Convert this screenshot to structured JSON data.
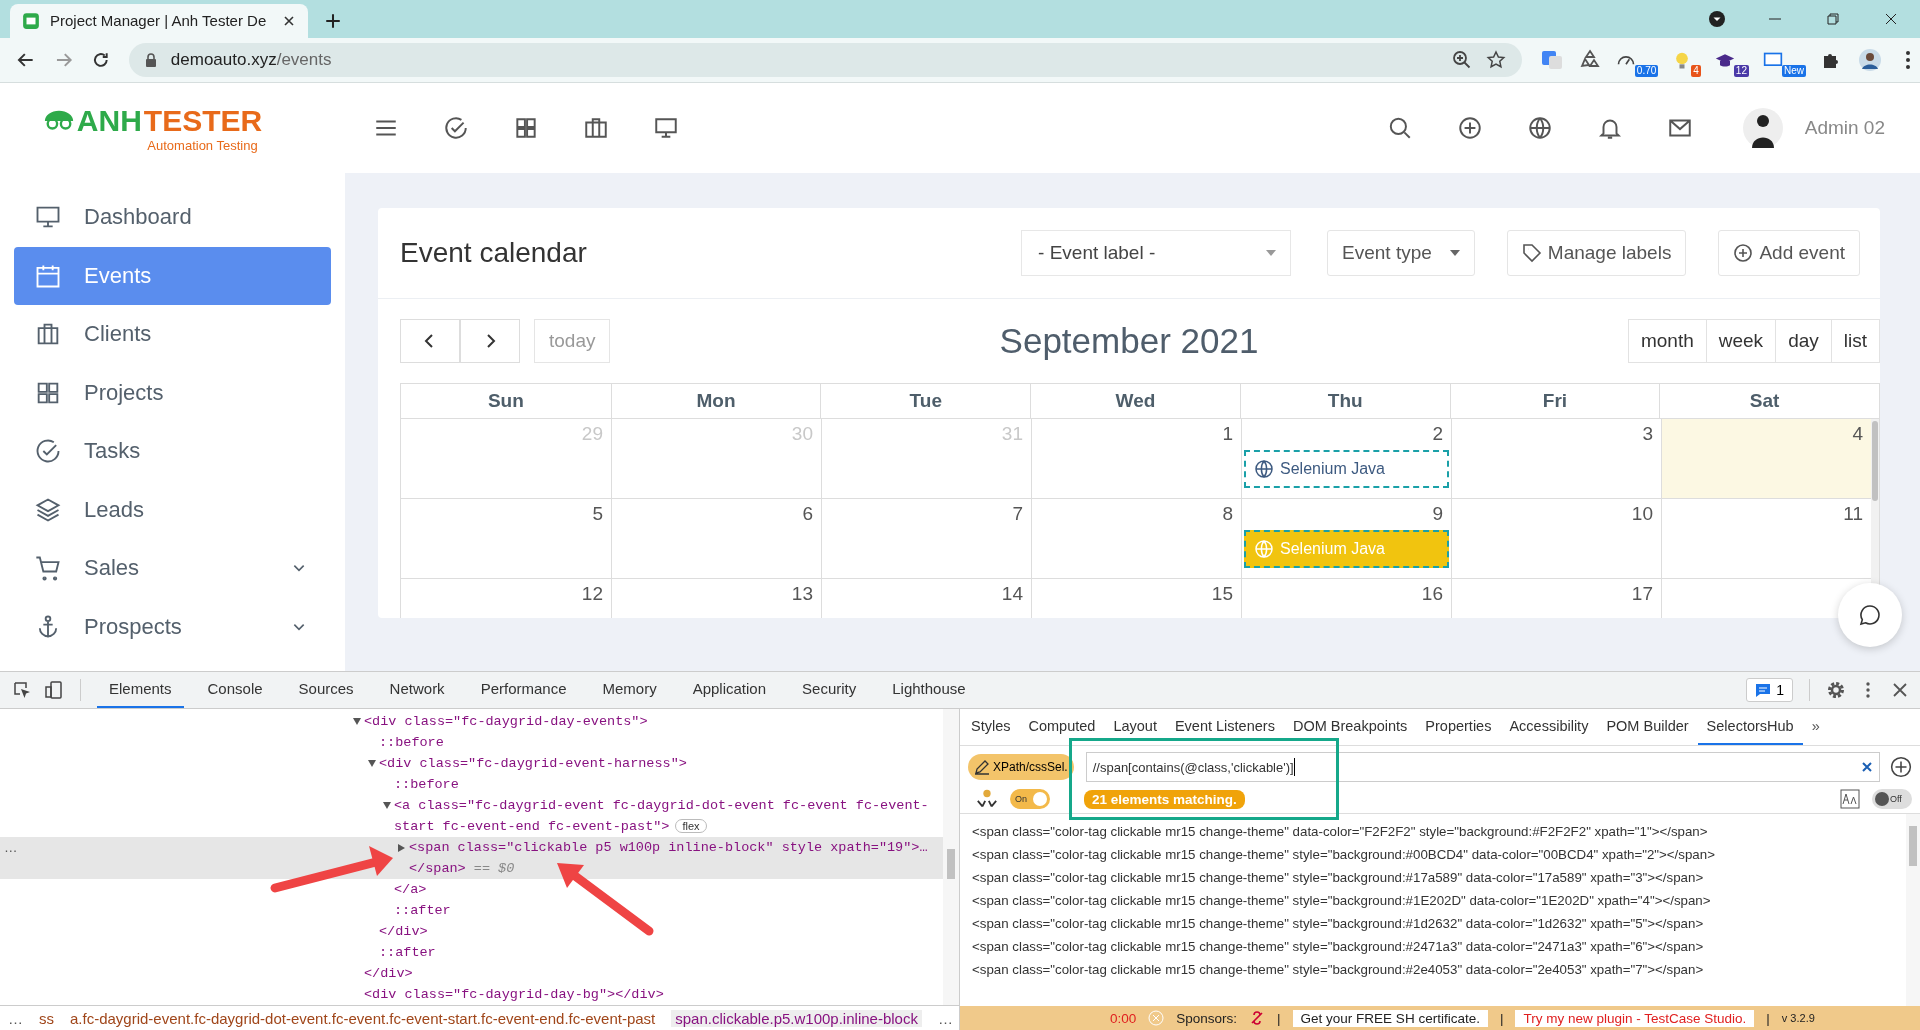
{
  "browser": {
    "tab_title": "Project Manager | Anh Tester De",
    "url_host": "demoauto.xyz",
    "url_path": "/events",
    "extension_badges": [
      "0.70",
      "4",
      "12",
      "New"
    ]
  },
  "header": {
    "logo_part_1": "ANH",
    "logo_part_2": "TESTER",
    "logo_tagline": "Automation Testing",
    "user": "Admin 02"
  },
  "sidebar": {
    "items": [
      {
        "label": "Dashboard",
        "selected": false,
        "submenu": false
      },
      {
        "label": "Events",
        "selected": true,
        "submenu": false
      },
      {
        "label": "Clients",
        "selected": false,
        "submenu": false
      },
      {
        "label": "Projects",
        "selected": false,
        "submenu": false
      },
      {
        "label": "Tasks",
        "selected": false,
        "submenu": false
      },
      {
        "label": "Leads",
        "selected": false,
        "submenu": false
      },
      {
        "label": "Sales",
        "selected": false,
        "submenu": true
      },
      {
        "label": "Prospects",
        "selected": false,
        "submenu": true
      }
    ]
  },
  "calendar": {
    "title": "Event calendar",
    "event_label_select": "- Event label -",
    "event_type": "Event type",
    "manage_labels": "Manage labels",
    "add_event": "Add event",
    "today": "today",
    "month_title": "September 2021",
    "views": [
      "month",
      "week",
      "day",
      "list"
    ],
    "weekdays": [
      "Sun",
      "Mon",
      "Tue",
      "Wed",
      "Thu",
      "Fri",
      "Sat"
    ],
    "weeks": [
      [
        {
          "day": "29",
          "other_month": true,
          "today": false
        },
        {
          "day": "30",
          "other_month": true,
          "today": false
        },
        {
          "day": "31",
          "other_month": true,
          "today": false
        },
        {
          "day": "1",
          "other_month": false,
          "today": false
        },
        {
          "day": "2",
          "other_month": false,
          "today": false,
          "events": [
            {
              "label": "Selenium Java",
              "selected": false
            }
          ]
        },
        {
          "day": "3",
          "other_month": false,
          "today": false
        },
        {
          "day": "4",
          "other_month": false,
          "today": true
        }
      ],
      [
        {
          "day": "5",
          "other_month": false,
          "today": false
        },
        {
          "day": "6",
          "other_month": false,
          "today": false
        },
        {
          "day": "7",
          "other_month": false,
          "today": false
        },
        {
          "day": "8",
          "other_month": false,
          "today": false
        },
        {
          "day": "9",
          "other_month": false,
          "today": false,
          "events": [
            {
              "label": "Selenium Java",
              "selected": true
            }
          ]
        },
        {
          "day": "10",
          "other_month": false,
          "today": false
        },
        {
          "day": "11",
          "other_month": false,
          "today": false
        }
      ],
      [
        {
          "day": "12",
          "other_month": false,
          "today": false
        },
        {
          "day": "13",
          "other_month": false,
          "today": false
        },
        {
          "day": "14",
          "other_month": false,
          "today": false
        },
        {
          "day": "15",
          "other_month": false,
          "today": false
        },
        {
          "day": "16",
          "other_month": false,
          "today": false
        },
        {
          "day": "17",
          "other_month": false,
          "today": false
        },
        {
          "today": false
        }
      ]
    ]
  },
  "devtools": {
    "tabs": [
      {
        "label": "Elements",
        "selected": true
      },
      {
        "label": "Console",
        "selected": false
      },
      {
        "label": "Sources",
        "selected": false
      },
      {
        "label": "Network",
        "selected": false
      },
      {
        "label": "Performance",
        "selected": false
      },
      {
        "label": "Memory",
        "selected": false
      },
      {
        "label": "Application",
        "selected": false
      },
      {
        "label": "Security",
        "selected": false
      },
      {
        "label": "Lighthouse",
        "selected": false
      }
    ],
    "issues_count": "1",
    "tree": [
      {
        "text": "<div class=\"fc-daygrid-day-events\">",
        "expanded": true,
        "selected": false,
        "children": [
          {
            "text": "::before",
            "selected": false
          },
          {
            "text": "<div class=\"fc-daygrid-event-harness\">",
            "expanded": true,
            "selected": false,
            "children": [
              {
                "text": "::before",
                "selected": false
              },
              {
                "text": "<a class=\"fc-daygrid-event fc-daygrid-dot-event fc-event fc-event-start fc-event-end fc-event-past\">",
                "badge": "flex",
                "expanded": true,
                "selected": false,
                "children": [
                  {
                    "text": "<span class=\"clickable p5 w100p inline-block\" style xpath=\"19\">…",
                    "expanded": false,
                    "selected": true,
                    "gutter": "…",
                    "close": "</span>",
                    "close_note": "== $0"
                  }
                ]
              },
              {
                "text": "</a>",
                "selected": false
              },
              {
                "text": "::after",
                "selected": false
              }
            ]
          },
          {
            "text": "</div>",
            "selected": false
          },
          {
            "text": "::after",
            "selected": false
          }
        ]
      },
      {
        "text": "</div>",
        "selected": false
      },
      {
        "text": "<div class=\"fc-daygrid-day-bg\"></div>",
        "selected": false
      }
    ],
    "breadcrumb_more": "…",
    "breadcrumb": [
      {
        "label": "ss",
        "selected": false
      },
      {
        "label": "a.fc-daygrid-event.fc-daygrid-dot-event.fc-event.fc-event-start.fc-event-end.fc-event-past",
        "selected": false
      },
      {
        "label": "span.clickable.p5.w100p.inline-block",
        "selected": true
      }
    ],
    "breadcrumb_more_end": "…",
    "side_tabs": [
      {
        "label": "Styles",
        "selected": false
      },
      {
        "label": "Computed",
        "selected": false
      },
      {
        "label": "Layout",
        "selected": false
      },
      {
        "label": "Event Listeners",
        "selected": false
      },
      {
        "label": "DOM Breakpoints",
        "selected": false
      },
      {
        "label": "Properties",
        "selected": false
      },
      {
        "label": "Accessibility",
        "selected": false
      },
      {
        "label": "POM Builder",
        "selected": false
      },
      {
        "label": "SelectorsHub",
        "selected": true
      }
    ],
    "side_more": "»",
    "selectors_hub": {
      "mode_button": "XPath/cssSel.",
      "selector": "//span[contains(@class,'clickable')]",
      "match_count": "21 elements matching.",
      "toggle_label": "On",
      "toggle_on": true,
      "case_toggle_label": "Off",
      "case_toggle_on": false,
      "results": [
        "<span class=\"color-tag clickable mr15 change-theme\" data-color=\"F2F2F2\" style=\"background:#F2F2F2\" xpath=\"1\"></span>",
        "<span class=\"color-tag clickable mr15 change-theme\" style=\"background:#00BCD4\" data-color=\"00BCD4\" xpath=\"2\"></span>",
        "<span class=\"color-tag clickable mr15 change-theme\" style=\"background:#17a589\" data-color=\"17a589\" xpath=\"3\"></span>",
        "<span class=\"color-tag clickable mr15 change-theme\" style=\"background:#1E202D\" data-color=\"1E202D\" xpath=\"4\"></span>",
        "<span class=\"color-tag clickable mr15 change-theme\" style=\"background:#1d2632\" data-color=\"1d2632\" xpath=\"5\"></span>",
        "<span class=\"color-tag clickable mr15 change-theme\" style=\"background:#2471a3\" data-color=\"2471a3\" xpath=\"6\"></span>",
        "<span class=\"color-tag clickable mr15 change-theme\" style=\"background:#2e4053\" data-color=\"2e4053\" xpath=\"7\"></span>"
      ],
      "footer": {
        "timer": "0:00",
        "sponsors": "Sponsors:",
        "separator": "|",
        "certificate": "Get your FREE SH certificate.",
        "plugin": "Try my new plugin - TestCase Studio.",
        "version": "v 3.2.9"
      }
    }
  }
}
